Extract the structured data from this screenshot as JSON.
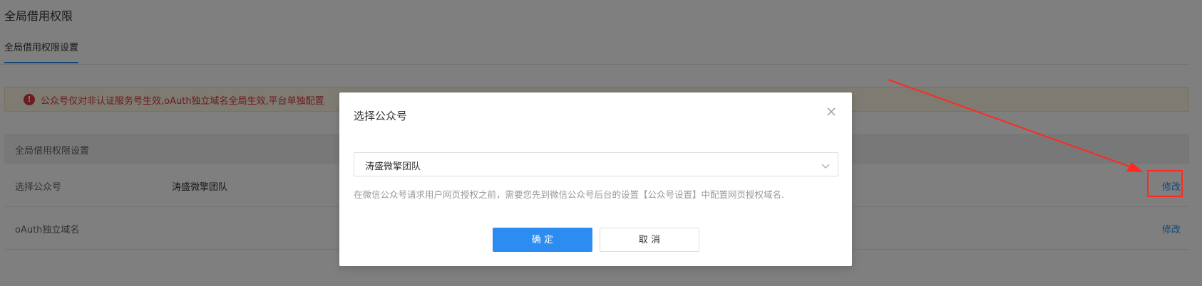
{
  "page": {
    "title": "全局借用权限",
    "tab_active": "全局借用权限设置",
    "alert_icon": "!",
    "alert_text": "公众号仅对非认证服务号生效,oAuth独立域名全局生效,平台单独配置"
  },
  "settings": {
    "section_title": "全局借用权限设置",
    "rows": [
      {
        "label": "选择公众号",
        "value": "涛盛微擎团队",
        "action": "修改"
      },
      {
        "label": "oAuth独立域名",
        "value": "",
        "action": "修改"
      }
    ]
  },
  "modal": {
    "title": "选择公众号",
    "close_icon": "close-icon",
    "select_value": "涛盛微擎团队",
    "help_text": "在微信公众号请求用户网页授权之前，需要您先到微信公众号后台的设置【公众号设置】中配置网页授权域名.",
    "ok_label": "确 定",
    "cancel_label": "取 消"
  },
  "colors": {
    "primary": "#2d8cf0",
    "alert_text": "#d9363e",
    "annotation": "#ff2a1f"
  }
}
